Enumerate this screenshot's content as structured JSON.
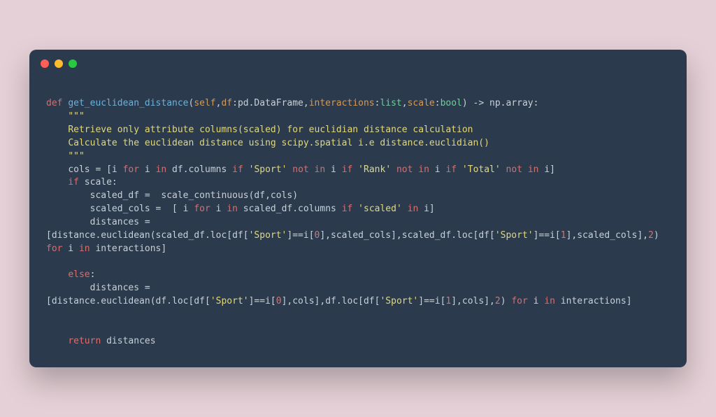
{
  "code": {
    "line1": {
      "def": "def",
      "fn_name": "get_euclidean_distance",
      "open_paren": "(",
      "self": "self",
      "comma1": ",",
      "df": "df",
      "colon1": ":",
      "pd_dataframe": "pd.DataFrame",
      "comma2": ",",
      "interactions": "interactions",
      "colon2": ":",
      "list": "list",
      "comma3": ",",
      "scale": "scale",
      "colon3": ":",
      "bool": "bool",
      "close_paren": ")",
      "arrow": " -> ",
      "np_array": "np.array",
      "end_colon": ":"
    },
    "docstring_open": "    \"\"\"",
    "docstring_line1": "    Retrieve only attribute columns(scaled) for euclidian distance calculation",
    "docstring_line2": "    Calculate the euclidean distance using scipy.spatial i.e distance.euclidian()",
    "docstring_close": "    \"\"\"",
    "line_cols": {
      "indent": "    ",
      "cols": "cols = [i ",
      "for1": "for",
      "i_in": " i ",
      "in1": "in",
      "df_columns": " df.columns ",
      "if1": "if",
      "sport": " 'Sport' ",
      "not1": "not",
      "in2": " in",
      "i2": " i ",
      "if2": "if",
      "rank": " 'Rank' ",
      "not2": "not",
      "in3": " in",
      "i3": " i ",
      "if3": "if",
      "total": " 'Total' ",
      "not3": "not",
      "in4": " in",
      "i4": " i]"
    },
    "line_if_scale": {
      "indent": "    ",
      "if": "if",
      "scale": " scale:"
    },
    "line_scaled_df": "        scaled_df =  scale_continuous(df,cols)",
    "line_scaled_cols": {
      "indent": "        scaled_cols =  [ i ",
      "for": "for",
      "i_in": " i ",
      "in": "in",
      "scaled_df": " scaled_df.columns ",
      "if": "if",
      "scaled_str": " 'scaled' ",
      "in2": "in",
      "i_end": " i]"
    },
    "line_distances1": "        distances = ",
    "line_dist_expr1": {
      "start": "[distance.euclidean(scaled_df.loc[df[",
      "sport1": "'Sport'",
      "mid1": "]==i[",
      "zero": "0",
      "mid2": "],scaled_cols],scaled_df.loc[df[",
      "sport2": "'Sport'",
      "mid3": "]==i[",
      "one": "1",
      "mid4": "],scaled_cols],",
      "two": "2",
      "mid5": ") ",
      "for": "for",
      "i_in": " i ",
      "in": "in",
      "end": " interactions]"
    },
    "line_else": {
      "indent": "    ",
      "else": "else",
      "colon": ":"
    },
    "line_distances2": "        distances = ",
    "line_dist_expr2": {
      "start": "[distance.euclidean(df.loc[df[",
      "sport1": "'Sport'",
      "mid1": "]==i[",
      "zero": "0",
      "mid2": "],cols],df.loc[df[",
      "sport2": "'Sport'",
      "mid3": "]==i[",
      "one": "1",
      "mid4": "],cols],",
      "two": "2",
      "mid5": ") ",
      "for": "for",
      "i_in": " i ",
      "in": "in",
      "end": " interactions]"
    },
    "line_return": {
      "indent": "    ",
      "return": "return",
      "distances": " distances"
    }
  }
}
